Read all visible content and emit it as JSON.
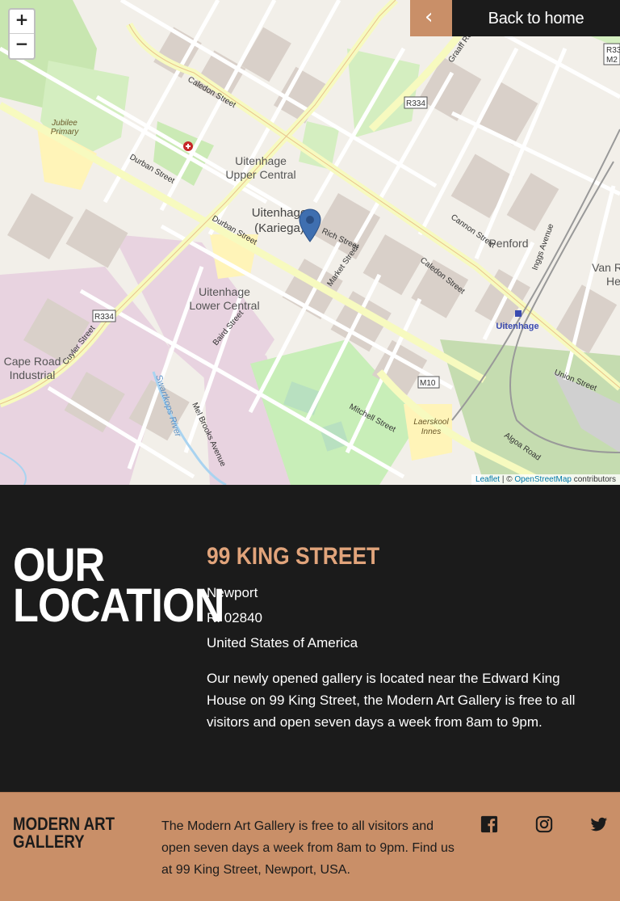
{
  "map": {
    "zoom_in": "+",
    "zoom_out": "−",
    "attribution_leaflet": "Leaflet",
    "attribution_sep": " | © ",
    "attribution_osm": "OpenStreetMap",
    "attribution_rest": " contributors",
    "labels": {
      "uitenhage_upper": "Uitenhage",
      "upper_central": "Upper Central",
      "uitenhage_center": "Uitenhage",
      "kariega": "(Kariega)",
      "lower": "Uitenhage",
      "lower_central": "Lower Central",
      "cape_road": "Cape Road",
      "industrial": "Industrial",
      "penford": "Penford",
      "van_r": "Van R",
      "he": "He",
      "jubilee": "Jubilee",
      "primary": "Primary",
      "laerskool": "Laerskool",
      "innes": "Innes",
      "uitenhage_station": "Uitenhage",
      "swartkops": "Swartkops River",
      "caledon1": "Caledon Street",
      "caledon2": "Caledon Street",
      "durban1": "Durban Street",
      "durban2": "Durban Street",
      "union": "Union Street",
      "graaff": "Graaff Re",
      "algoa": "Algoa Road",
      "cuyler": "Cuyler Street",
      "mel_brooks": "Mel Brooks Avenue",
      "r334_a": "R334",
      "r334_b": "R334",
      "m10": "M10",
      "r33": "R33",
      "m2": "M2",
      "rich": "Rich Street",
      "market": "Market Street",
      "cannon": "Cannon Street",
      "mitchell": "Mitchell Street",
      "baird": "Baird Street",
      "inggs": "Inggs Avenue"
    }
  },
  "nav": {
    "back_arrow": "‹",
    "back_label": "Back to home"
  },
  "location": {
    "title_line1": "OUR",
    "title_line2": "LOCATION",
    "address_heading": "99 KING STREET",
    "city": "Newport",
    "postcode": "RI 02840",
    "country": "United States of America",
    "description": "Our newly opened gallery is located near the Edward King House on 99 King Street, the Modern Art Gallery is free to all visitors and open seven days a week from 8am to 9pm."
  },
  "footer": {
    "brand_line1": "MODERN ART",
    "brand_line2": "GALLERY",
    "description": "The Modern Art Gallery is free to all visitors and open seven days a week from 8am to 9pm. Find us at 99 King Street, Newport, USA.",
    "social": [
      "facebook-icon",
      "instagram-icon",
      "twitter-icon"
    ]
  }
}
